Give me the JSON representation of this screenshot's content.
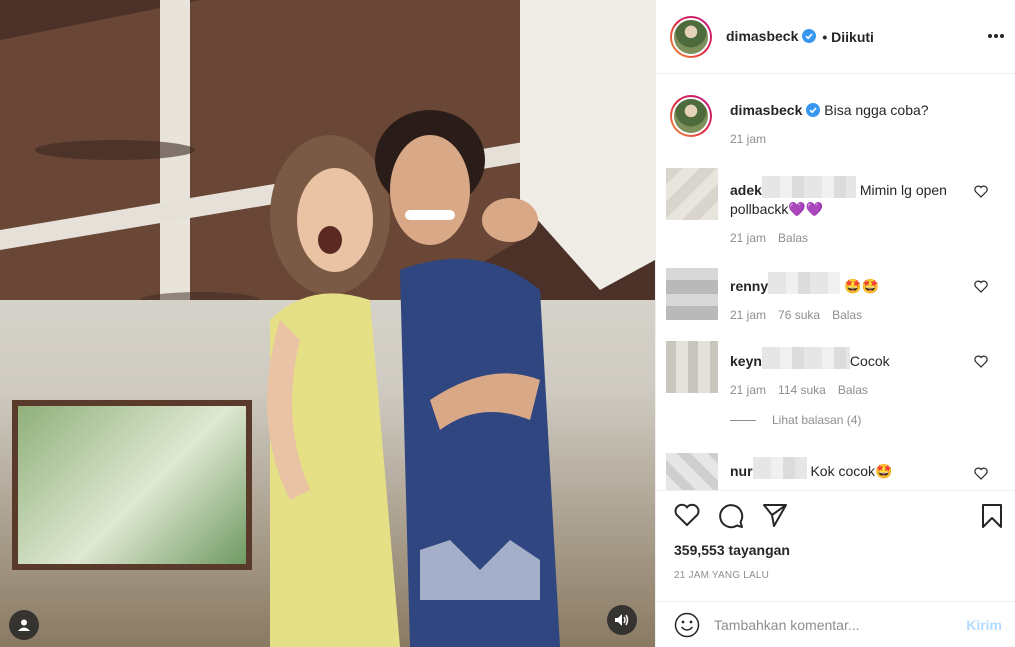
{
  "header": {
    "username": "dimasbeck",
    "follow_status": "• Diikuti",
    "more_icon": "more-horizontal-icon"
  },
  "caption": {
    "username": "dimasbeck",
    "text": "Bisa ngga coba?",
    "time": "21 jam"
  },
  "comments": [
    {
      "user": "adek",
      "text": "Mimin lg open pollbackk💜💜",
      "time": "21 jam",
      "likes": "",
      "reply": "Balas"
    },
    {
      "user": "renny",
      "text": "🤩🤩",
      "time": "21 jam",
      "likes": "76 suka",
      "reply": "Balas"
    },
    {
      "user": "keyn",
      "text": "Cocok",
      "time": "21 jam",
      "likes": "114 suka",
      "reply": "Balas",
      "view_replies": "Lihat balasan (4)"
    },
    {
      "user": "nur",
      "text": "Kok cocok🤩"
    }
  ],
  "stats": {
    "views": "359,553 tayangan",
    "posted": "21 JAM YANG LALU"
  },
  "add_comment": {
    "placeholder": "Tambahkan komentar...",
    "post_label": "Kirim"
  },
  "colors": {
    "verified": "#3897f0",
    "post_button_disabled": "#b3dbff",
    "muted_text": "#8e8e8e"
  }
}
